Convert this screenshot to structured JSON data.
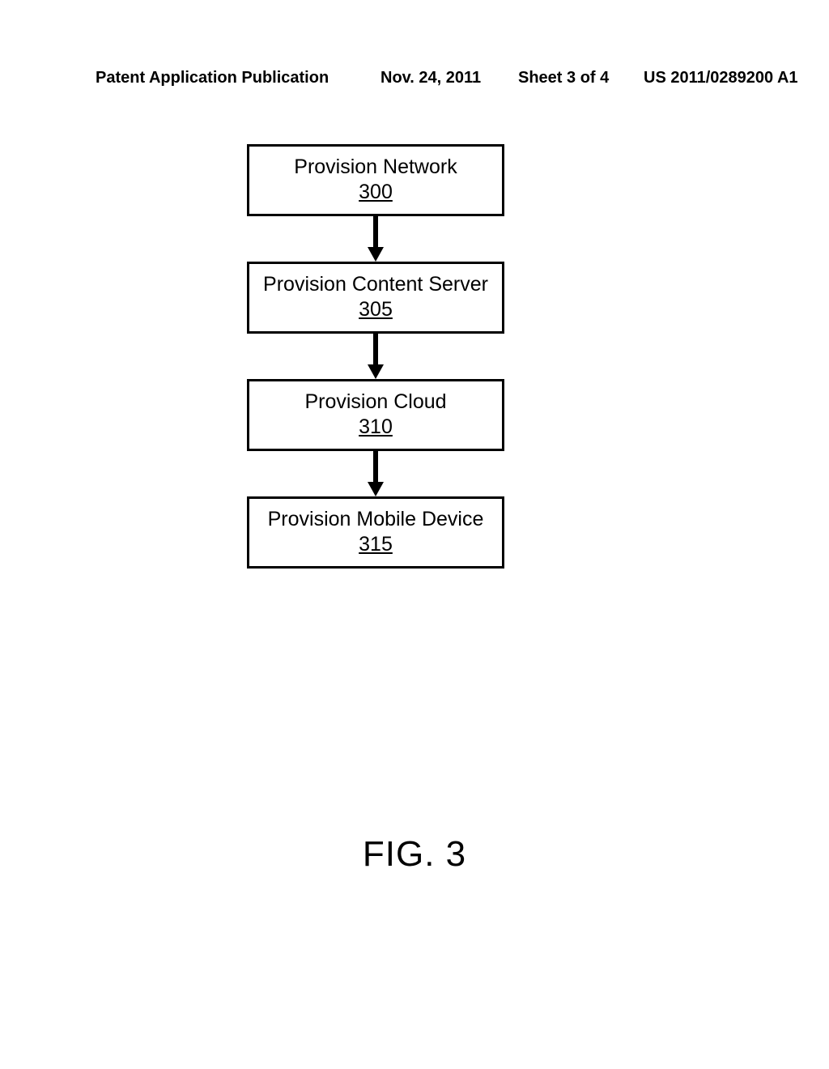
{
  "header": {
    "publication_label": "Patent Application Publication",
    "date": "Nov. 24, 2011",
    "sheet": "Sheet 3 of 4",
    "publication_number": "US 2011/0289200 A1"
  },
  "diagram": {
    "boxes": [
      {
        "title": "Provision Network",
        "ref": "300"
      },
      {
        "title": "Provision Content Server",
        "ref": "305"
      },
      {
        "title": "Provision Cloud",
        "ref": "310"
      },
      {
        "title": "Provision Mobile Device",
        "ref": "315"
      }
    ]
  },
  "figure_label": "FIG. 3"
}
